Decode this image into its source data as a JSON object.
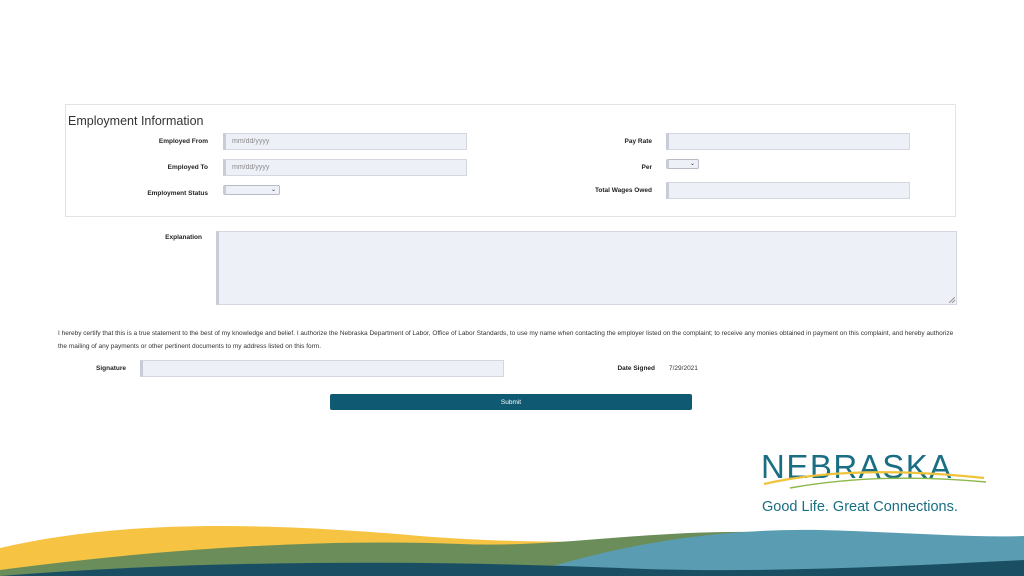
{
  "section": {
    "title": "Employment Information"
  },
  "fields": {
    "employed_from": {
      "label": "Employed From",
      "placeholder": "mm/dd/yyyy"
    },
    "employed_to": {
      "label": "Employed To",
      "placeholder": "mm/dd/yyyy"
    },
    "employment_status": {
      "label": "Employment Status"
    },
    "pay_rate": {
      "label": "Pay Rate"
    },
    "per": {
      "label": "Per"
    },
    "total_wages_owed": {
      "label": "Total Wages Owed"
    },
    "explanation": {
      "label": "Explanation"
    },
    "signature": {
      "label": "Signature"
    },
    "date_signed": {
      "label": "Date Signed",
      "value": "7/29/2021"
    }
  },
  "certification_text": "I hereby certify that this is a true statement to the best of my knowledge and belief. I authorize the Nebraska Department of Labor, Office of Labor Standards, to use my name when contacting the employer listed on the complaint; to receive any monies obtained in payment on this complaint, and hereby authorize the mailing of any payments or other pertinent documents to my address listed on this form.",
  "submit_label": "Submit",
  "branding": {
    "wordmark": "NEBRASKA",
    "tagline": "Good Life. Great Connections."
  },
  "colors": {
    "brand_teal": "#1a6e83",
    "button": "#0f5a72",
    "wave_yellow": "#f6c343",
    "wave_green": "#6a8d5a",
    "wave_blue": "#5a9db3",
    "wave_navy": "#1a4f63"
  }
}
